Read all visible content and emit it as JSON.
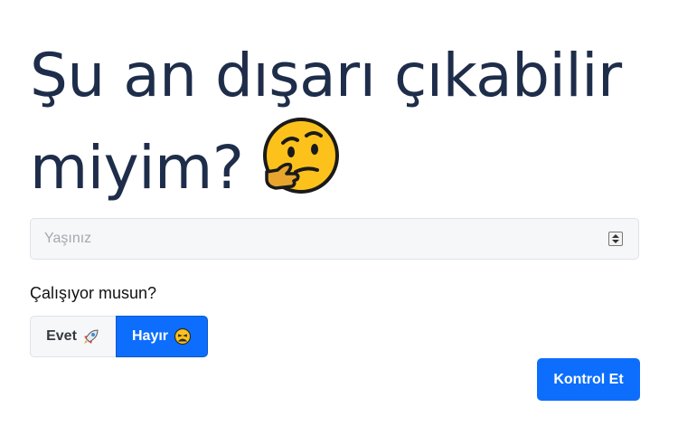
{
  "page": {
    "title": "Şu an dışarı çıkabilir miyim?",
    "title_emoji": "thinking-face-icon"
  },
  "form": {
    "age_input": {
      "placeholder": "Yaşınız",
      "value": ""
    },
    "question": "Çalışıyor musun?",
    "options": {
      "yes_label": "Evet",
      "yes_icon": "rocket-icon",
      "no_label": "Hayır",
      "no_icon": "weary-face-icon",
      "selected": "no"
    },
    "submit_label": "Kontrol Et"
  },
  "colors": {
    "primary": "#0d6efd",
    "title_text": "#1e2d4a",
    "input_bg": "#f6f7f9",
    "border": "#dee2e6"
  }
}
